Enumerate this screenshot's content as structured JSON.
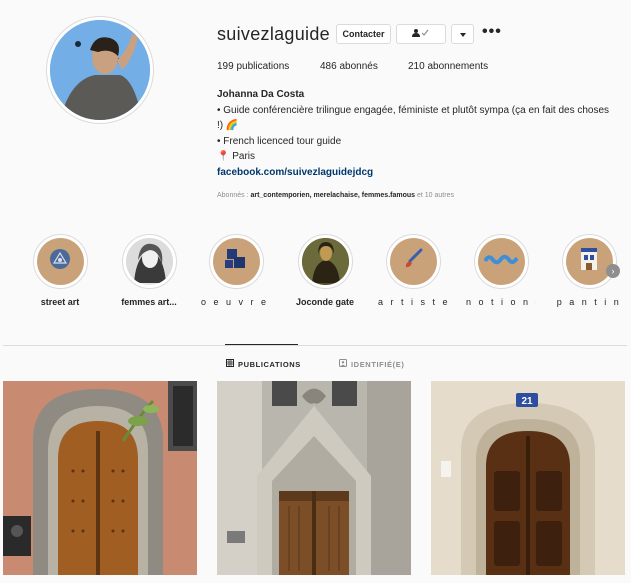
{
  "profile": {
    "username": "suivezlaguide",
    "contact_label": "Contacter",
    "stats": {
      "posts": "199 publications",
      "followers": "486 abonnés",
      "following": "210 abonnements"
    },
    "bio": {
      "name": "Johanna Da Costa",
      "line1": "• Guide conférencière trilingue engagée, féministe et plutôt sympa (ça en fait des choses !) 🌈",
      "line2": "• French licenced tour guide",
      "line3": "📍 Paris",
      "link": "facebook.com/suivezlaguidejdcg"
    },
    "followed_by": {
      "prefix": "Abonnés : ",
      "accounts": "art_contemporien, merelachaise, femmes.famous",
      "suffix": " et 10 autres"
    }
  },
  "highlights": [
    {
      "label": "street art",
      "icon": "street-art-icon"
    },
    {
      "label": "femmes art...",
      "icon": "portrait-photo"
    },
    {
      "label": "o e u v r e s",
      "icon": "artworks-icon"
    },
    {
      "label": "Joconde gate",
      "icon": "mona-lisa-photo"
    },
    {
      "label": "a r t i s t e s",
      "icon": "paintbrush-icon"
    },
    {
      "label": "n o t i o n s",
      "icon": "wave-icon"
    },
    {
      "label": "p a n t i n",
      "icon": "building-icon"
    }
  ],
  "tabs": {
    "posts": "PUBLICATIONS",
    "tagged": "IDENTIFIÉ(E)"
  },
  "posts": [
    {
      "alt": "wooden door in stone arch"
    },
    {
      "alt": "gothic doorway"
    },
    {
      "alt": "door number 21"
    }
  ],
  "post3_number": "21",
  "colors": {
    "accent": "#0095f6",
    "link": "#00376b",
    "highlight_bg": "#caa279",
    "border": "#dbdbdb",
    "muted": "#8e8e8e"
  }
}
